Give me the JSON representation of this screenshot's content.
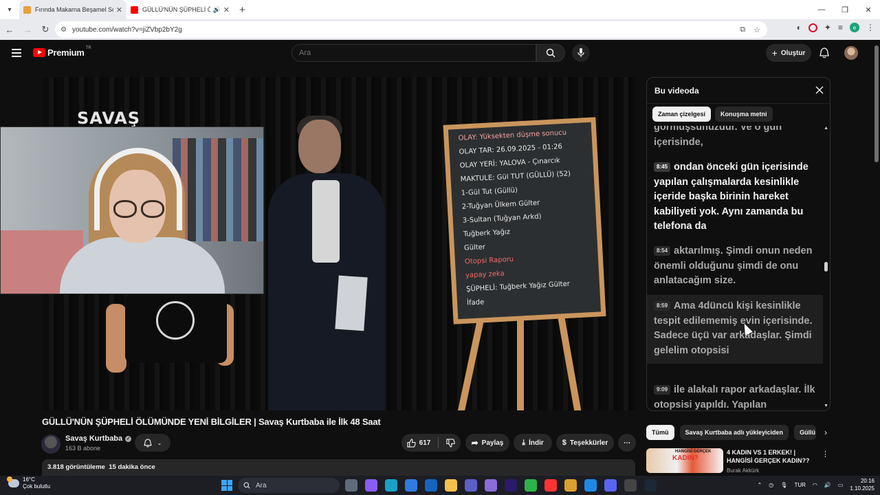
{
  "browser": {
    "tabs": [
      {
        "title": "Fırında Makarna Beşamel Soslu",
        "active": true,
        "favicon_color": "#e8a03a"
      },
      {
        "title": "GÜLLÜ'NÜN ŞÜPHELİ ÖLÜMÜNDE",
        "active": false,
        "favicon_color": "#ff0000"
      }
    ],
    "url": "youtube.com/watch?v=jiZVbp2bY2g"
  },
  "yt": {
    "logo_text": "Premium",
    "region": "TR",
    "search_placeholder": "Ara",
    "create_label": "Oluştur"
  },
  "player": {
    "brand_text": "SAVAŞ",
    "board_lines": [
      {
        "text": "OLAY: Yüksekten düşme sonucu",
        "color": "#f0a3a3"
      },
      {
        "text": "OLAY TAR: 26.09.2025 - 01:26",
        "color": "#e8e8e8"
      },
      {
        "text": "OLAY YERİ: YALOVA - Çınarcık",
        "color": "#e8e8e8"
      },
      {
        "text": "MAKTULE: Gül TUT (GÜLLÜ) (52)",
        "color": "#e8e8e8"
      },
      {
        "text": "1-Gül Tut (Güllü)",
        "color": "#e8e8e8"
      },
      {
        "text": "2-Tuğyan Ülkem Gülter",
        "color": "#e8e8e8"
      },
      {
        "text": "3-Sultan (Tuğyan Arkd)",
        "color": "#e8e8e8"
      },
      {
        "text": "Tuğberk Yağız",
        "color": "#e8e8e8"
      },
      {
        "text": "Gülter",
        "color": "#e8e8e8"
      },
      {
        "text": "Otopsi Raporu",
        "color": "#f06a6a"
      },
      {
        "text": "yapay zeka",
        "color": "#f06a6a"
      },
      {
        "text": "ŞÜPHELİ: Tuğberk Yağız Gülter",
        "color": "#e8e8e8"
      },
      {
        "text": "İfade",
        "color": "#e8e8e8"
      }
    ]
  },
  "panel": {
    "title": "Bu videoda",
    "chips": [
      {
        "label": "Zaman çizelgesi",
        "active": true
      },
      {
        "label": "Konuşma metni",
        "active": false
      }
    ],
    "segments": [
      {
        "time": "",
        "text": "görmüşsünüzdür. Ve o gün içerisinde,"
      },
      {
        "time": "8:45",
        "text": "ondan önceki gün içerisinde yapılan çalışmalarda kesinlikle içeride başka birinin hareket kabiliyeti yok. Aynı zamanda bu telefona da"
      },
      {
        "time": "8:54",
        "text": "aktarılmış. Şimdi onun neden önemli olduğunu şimdi de onu anlatacağım size."
      },
      {
        "time": "8:59",
        "text": "Ama 4düncü kişi kesinlikle tespit edilememiş evin içerisinde. Sadece üçü var arkadaşlar. Şimdi gelelim otopsisi"
      },
      {
        "time": "9:09",
        "text": "ile alakalı rapor arkadaşlar. İlk otopsisi yapıldı. Yapılan"
      }
    ]
  },
  "video": {
    "title": "GÜLLÜ'NÜN ŞÜPHELİ ÖLÜMÜNDE YENİ BİLGİLER | Savaş Kurtbaba ile İlk 48 Saat",
    "channel": "Savaş Kurtbaba",
    "subscribers": "163 B abone",
    "likes": "617",
    "share_label": "Paylaş",
    "download_label": "İndir",
    "thanks_label": "Teşekkürler",
    "views": "3.818 görüntüleme",
    "age": "15 dakika önce"
  },
  "related": {
    "chips": [
      {
        "label": "Tümü",
        "active": true
      },
      {
        "label": "Savaş Kurtbaba adlı yükleyiciden",
        "active": false
      },
      {
        "label": "Güllü",
        "active": false
      }
    ],
    "video": {
      "thumb_tag": "HANGİSİ GERÇEK",
      "thumb_big": "KADIN?",
      "title": "4 KADIN VS 1 ERKEK! | HANGİSİ GERÇEK KADIN??",
      "channel": "Burak Akkürk"
    }
  },
  "taskbar": {
    "temperature": "16°C",
    "weather": "Çok bulutlu",
    "search_placeholder": "Ara",
    "language": "TUR",
    "time": "20:16",
    "date": "1.10.2025",
    "apps": [
      {
        "name": "task-view",
        "color": "#5f6b7a"
      },
      {
        "name": "copilot",
        "color": "#8a5cf6"
      },
      {
        "name": "edge",
        "color": "#1aa0c8"
      },
      {
        "name": "store",
        "color": "#2f7be0"
      },
      {
        "name": "outlook",
        "color": "#1664c0"
      },
      {
        "name": "explorer",
        "color": "#f2c14e"
      },
      {
        "name": "teams",
        "color": "#5b5fc7"
      },
      {
        "name": "vs",
        "color": "#8b6cd9"
      },
      {
        "name": "premiere",
        "color": "#2a1a6a"
      },
      {
        "name": "chrome",
        "color": "#2db24a"
      },
      {
        "name": "yandex",
        "color": "#ff3333"
      },
      {
        "name": "figure",
        "color": "#d9a030"
      },
      {
        "name": "app-c",
        "color": "#1e88e5"
      },
      {
        "name": "app-disc",
        "color": "#5865f2"
      },
      {
        "name": "obs",
        "color": "#444444"
      },
      {
        "name": "steam",
        "color": "#1b2838"
      }
    ]
  }
}
